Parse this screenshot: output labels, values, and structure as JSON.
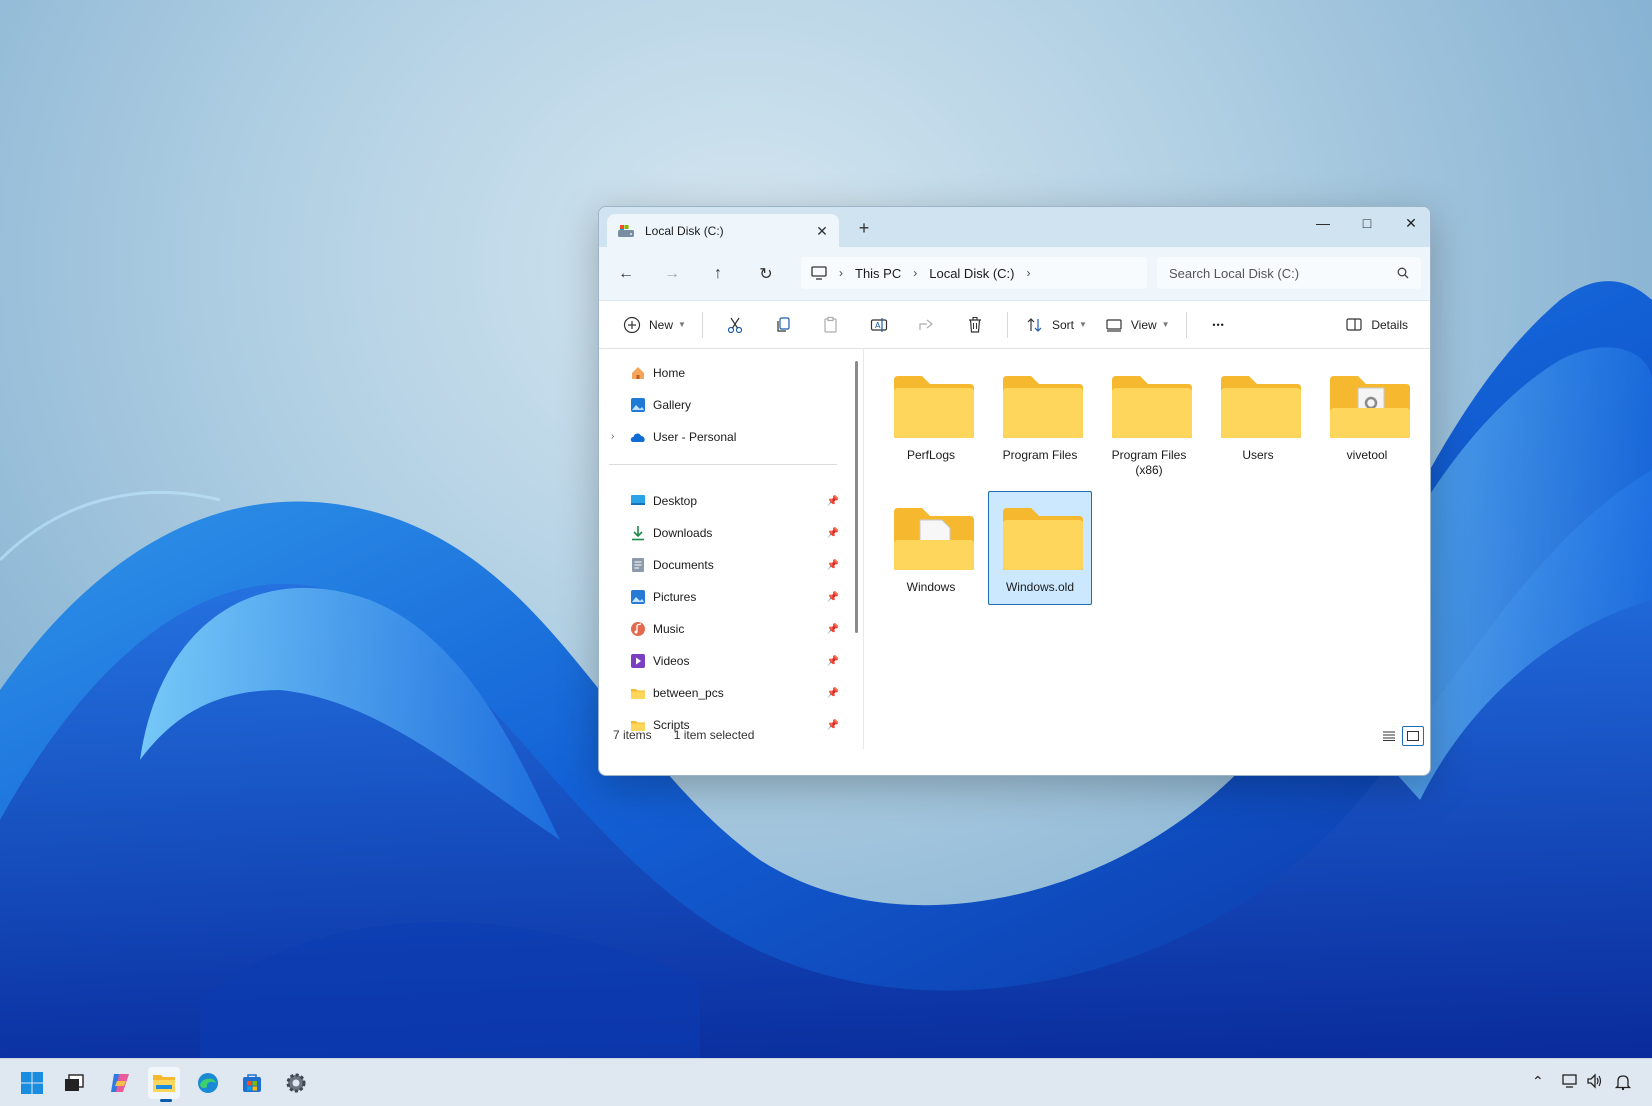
{
  "window": {
    "tab_title": "Local Disk (C:)",
    "new_tab_symbol": "+",
    "minimize_symbol": "—",
    "maximize_symbol": "□",
    "close_symbol": "✕",
    "tab_close_symbol": "✕"
  },
  "navigation": {
    "back_symbol": "←",
    "forward_symbol": "→",
    "up_symbol": "↑",
    "refresh_symbol": "↻",
    "breadcrumb": [
      "This PC",
      "Local Disk (C:)"
    ],
    "search_placeholder": "Search Local Disk (C:)"
  },
  "commands": {
    "new_label": "New",
    "sort_label": "Sort",
    "view_label": "View",
    "more_symbol": "•••",
    "details_label": "Details"
  },
  "nav_pane": {
    "top_items": [
      {
        "label": "Home",
        "icon": "home-icon"
      },
      {
        "label": "Gallery",
        "icon": "gallery-icon"
      },
      {
        "label": "User - Personal",
        "icon": "onedrive-icon"
      }
    ],
    "quick_access": [
      {
        "label": "Desktop",
        "icon": "desktop-icon"
      },
      {
        "label": "Downloads",
        "icon": "downloads-icon"
      },
      {
        "label": "Documents",
        "icon": "documents-icon"
      },
      {
        "label": "Pictures",
        "icon": "pictures-icon"
      },
      {
        "label": "Music",
        "icon": "music-icon"
      },
      {
        "label": "Videos",
        "icon": "videos-icon"
      },
      {
        "label": "between_pcs",
        "icon": "folder-icon"
      },
      {
        "label": "Scripts",
        "icon": "folder-icon"
      }
    ],
    "pin_symbol": "📌",
    "expander_symbol": "›"
  },
  "folders": [
    {
      "name": "PerfLogs",
      "type": "plain",
      "selected": false
    },
    {
      "name": "Program Files",
      "type": "plain",
      "selected": false
    },
    {
      "name": "Program Files\n(x86)",
      "type": "plain",
      "selected": false
    },
    {
      "name": "Users",
      "type": "plain",
      "selected": false
    },
    {
      "name": "vivetool",
      "type": "contents",
      "selected": false
    },
    {
      "name": "Windows",
      "type": "contents",
      "selected": false
    },
    {
      "name": "Windows.old",
      "type": "plain",
      "selected": true
    }
  ],
  "status": {
    "item_count": "7 items",
    "selection": "1 item selected"
  },
  "colors": {
    "accent": "#0b5cad",
    "folder_front": "#ffd65c",
    "folder_back": "#f5b82e",
    "selection_bg": "#cce8ff",
    "selection_border": "#1f6db5"
  },
  "taskbar": {
    "apps": [
      "start-icon",
      "task-view-icon",
      "copilot-icon",
      "file-explorer-icon",
      "edge-icon",
      "store-icon",
      "settings-icon"
    ],
    "tray_chevron": "⌃"
  }
}
